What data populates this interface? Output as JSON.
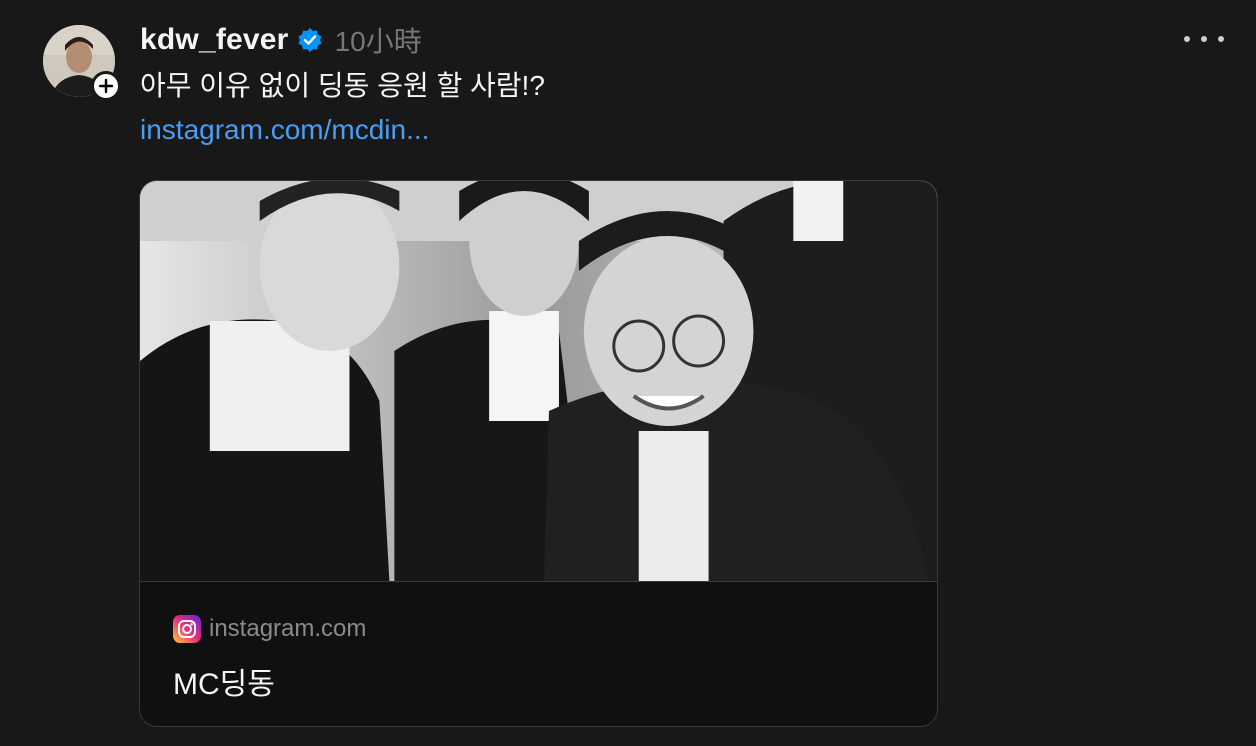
{
  "post": {
    "author": {
      "username": "kdw_fever",
      "verified": true,
      "avatar_icon": "user-avatar"
    },
    "timestamp": "10小時",
    "text": "아무 이유 없이 딩동 응원 할 사람!?",
    "link": "instagram.com/mcdin...",
    "more_icon": "ellipsis-icon",
    "follow_icon": "plus-icon"
  },
  "link_card": {
    "domain": "instagram.com",
    "title": "MC딩동",
    "domain_icon": "instagram-icon",
    "image_icon": "photo"
  },
  "colors": {
    "background": "#181818",
    "text": "#f3f5f7",
    "muted": "#777777",
    "link": "#4a9df5",
    "verified": "#0095f6"
  }
}
